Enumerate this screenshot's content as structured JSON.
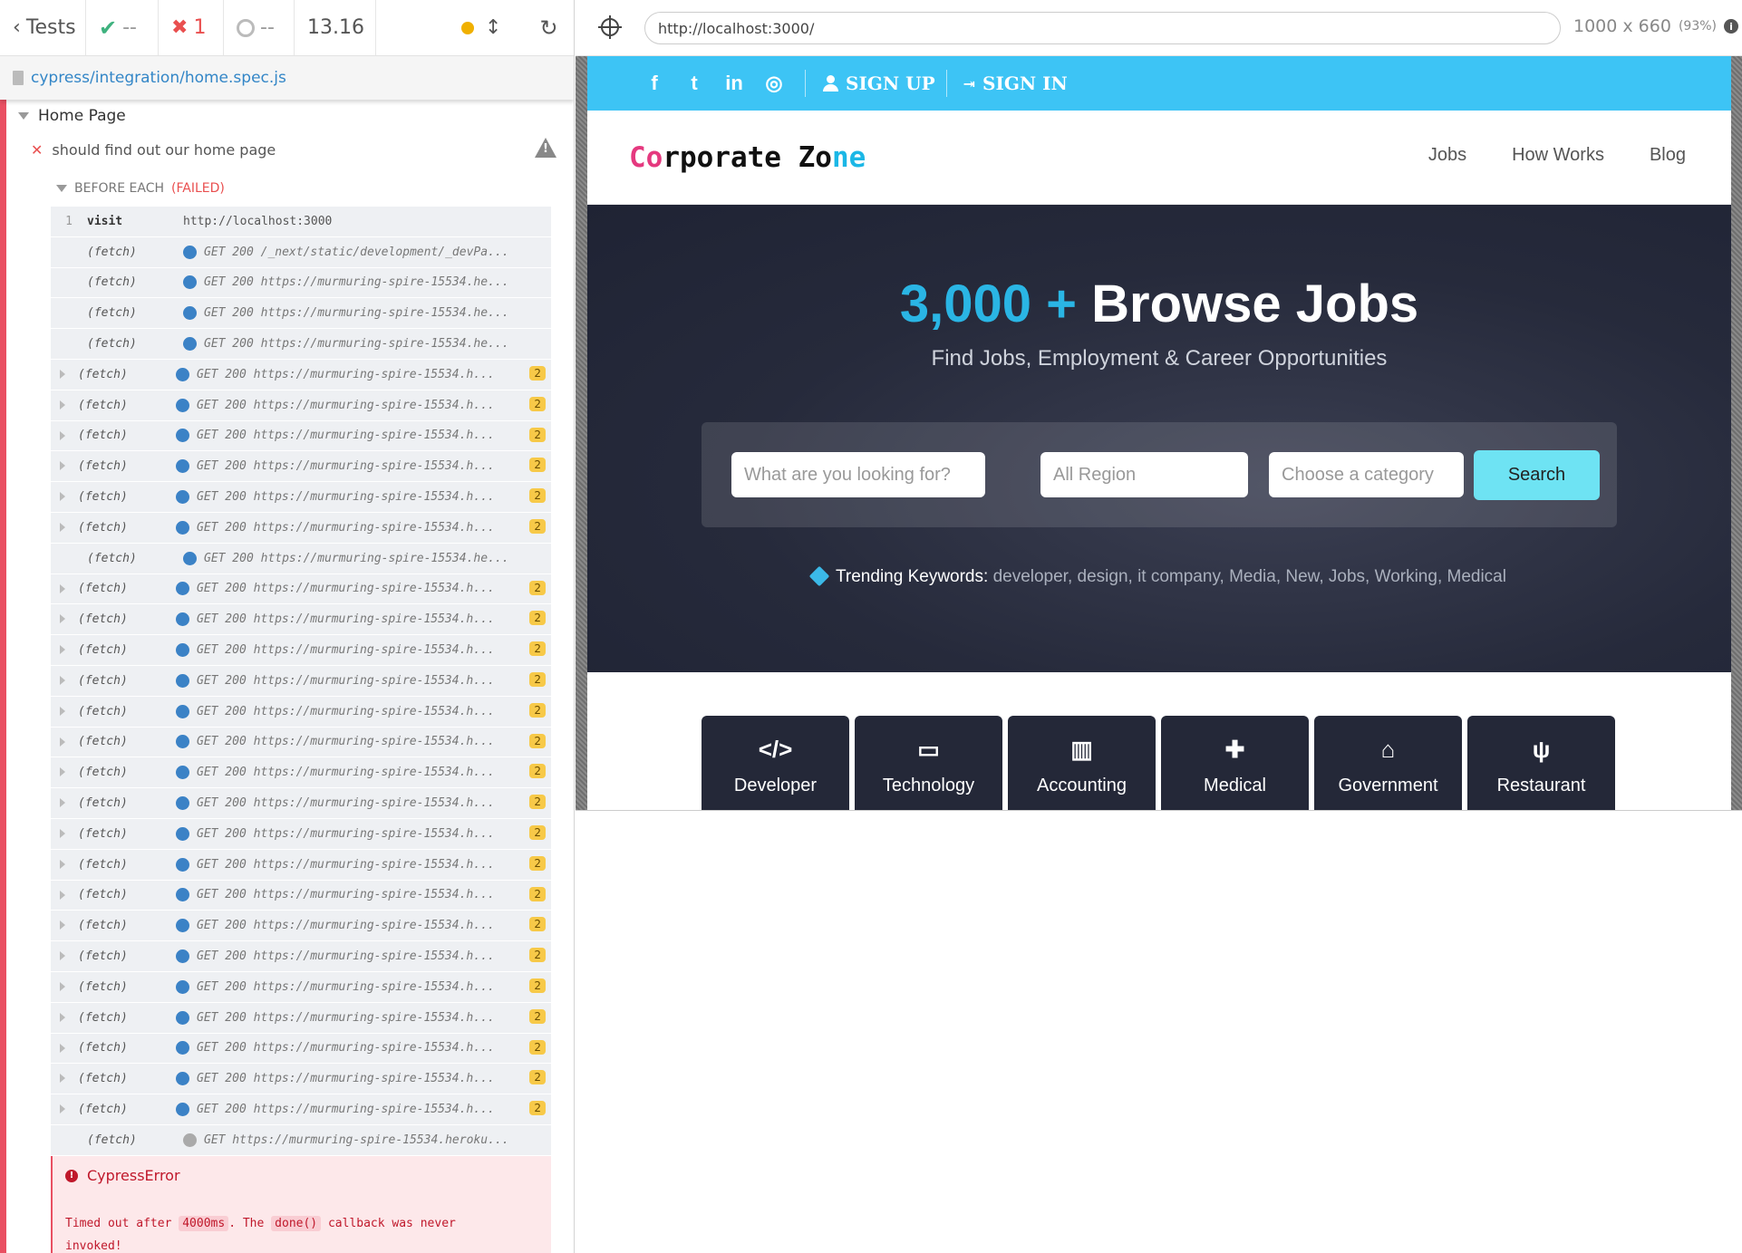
{
  "reporter": {
    "tests_label": "Tests",
    "passed": "--",
    "failed": "1",
    "pending": "--",
    "duration": "13.16",
    "spec_path": "cypress/integration/home.spec.js",
    "suite_title": "Home Page",
    "test_title": "should find out our home page",
    "hook_label": "BEFORE EACH",
    "hook_status": "(FAILED)",
    "commands": [
      {
        "num": "1",
        "name": "visit",
        "msg": "http://localhost:3000",
        "type": "visit"
      },
      {
        "name": "(fetch)",
        "msg": "GET 200 /_next/static/development/_devPa...",
        "type": "plain"
      },
      {
        "name": "(fetch)",
        "msg": "GET 200 https://murmuring-spire-15534.he...",
        "type": "plain"
      },
      {
        "name": "(fetch)",
        "msg": "GET 200 https://murmuring-spire-15534.he...",
        "type": "plain"
      },
      {
        "name": "(fetch)",
        "msg": "GET 200 https://murmuring-spire-15534.he...",
        "type": "plain"
      },
      {
        "name": "(fetch)",
        "msg": "GET 200 https://murmuring-spire-15534.h...",
        "type": "exp",
        "badge": "2"
      },
      {
        "name": "(fetch)",
        "msg": "GET 200 https://murmuring-spire-15534.h...",
        "type": "exp",
        "badge": "2"
      },
      {
        "name": "(fetch)",
        "msg": "GET 200 https://murmuring-spire-15534.h...",
        "type": "exp",
        "badge": "2"
      },
      {
        "name": "(fetch)",
        "msg": "GET 200 https://murmuring-spire-15534.h...",
        "type": "exp",
        "badge": "2"
      },
      {
        "name": "(fetch)",
        "msg": "GET 200 https://murmuring-spire-15534.h...",
        "type": "exp",
        "badge": "2"
      },
      {
        "name": "(fetch)",
        "msg": "GET 200 https://murmuring-spire-15534.h...",
        "type": "exp",
        "badge": "2"
      },
      {
        "name": "(fetch)",
        "msg": "GET 200 https://murmuring-spire-15534.he...",
        "type": "plain"
      },
      {
        "name": "(fetch)",
        "msg": "GET 200 https://murmuring-spire-15534.h...",
        "type": "exp",
        "badge": "2"
      },
      {
        "name": "(fetch)",
        "msg": "GET 200 https://murmuring-spire-15534.h...",
        "type": "exp",
        "badge": "2"
      },
      {
        "name": "(fetch)",
        "msg": "GET 200 https://murmuring-spire-15534.h...",
        "type": "exp",
        "badge": "2"
      },
      {
        "name": "(fetch)",
        "msg": "GET 200 https://murmuring-spire-15534.h...",
        "type": "exp",
        "badge": "2"
      },
      {
        "name": "(fetch)",
        "msg": "GET 200 https://murmuring-spire-15534.h...",
        "type": "exp",
        "badge": "2"
      },
      {
        "name": "(fetch)",
        "msg": "GET 200 https://murmuring-spire-15534.h...",
        "type": "exp",
        "badge": "2"
      },
      {
        "name": "(fetch)",
        "msg": "GET 200 https://murmuring-spire-15534.h...",
        "type": "exp",
        "badge": "2"
      },
      {
        "name": "(fetch)",
        "msg": "GET 200 https://murmuring-spire-15534.h...",
        "type": "exp",
        "badge": "2"
      },
      {
        "name": "(fetch)",
        "msg": "GET 200 https://murmuring-spire-15534.h...",
        "type": "exp",
        "badge": "2"
      },
      {
        "name": "(fetch)",
        "msg": "GET 200 https://murmuring-spire-15534.h...",
        "type": "exp",
        "badge": "2"
      },
      {
        "name": "(fetch)",
        "msg": "GET 200 https://murmuring-spire-15534.h...",
        "type": "exp",
        "badge": "2"
      },
      {
        "name": "(fetch)",
        "msg": "GET 200 https://murmuring-spire-15534.h...",
        "type": "exp",
        "badge": "2"
      },
      {
        "name": "(fetch)",
        "msg": "GET 200 https://murmuring-spire-15534.h...",
        "type": "exp",
        "badge": "2"
      },
      {
        "name": "(fetch)",
        "msg": "GET 200 https://murmuring-spire-15534.h...",
        "type": "exp",
        "badge": "2"
      },
      {
        "name": "(fetch)",
        "msg": "GET 200 https://murmuring-spire-15534.h...",
        "type": "exp",
        "badge": "2"
      },
      {
        "name": "(fetch)",
        "msg": "GET 200 https://murmuring-spire-15534.h...",
        "type": "exp",
        "badge": "2"
      },
      {
        "name": "(fetch)",
        "msg": "GET 200 https://murmuring-spire-15534.h...",
        "type": "exp",
        "badge": "2"
      },
      {
        "name": "(fetch)",
        "msg": "GET 200 https://murmuring-spire-15534.h...",
        "type": "exp",
        "badge": "2"
      },
      {
        "name": "(fetch)",
        "msg": "GET https://murmuring-spire-15534.heroku...",
        "type": "pending"
      }
    ],
    "error_title": "CypressError",
    "error_msg_1": "Timed out after",
    "error_code_1": "4000ms",
    "error_msg_2": ". The",
    "error_code_2": "done()",
    "error_msg_3": "callback was never",
    "error_msg_4": "invoked!"
  },
  "aut": {
    "url": "http://localhost:3000/",
    "viewport": "1000 x 660",
    "scale": "(93%)"
  },
  "site": {
    "social": [
      "f",
      "t",
      "in",
      "◎"
    ],
    "sign_up": "SIGN UP",
    "sign_in": "SIGN IN",
    "logo": {
      "p1": "Co",
      "p2": "rporate Zo",
      "p3": "ne"
    },
    "nav": [
      "Jobs",
      "How Works",
      "Blog"
    ],
    "hero_count": "3,000 +",
    "hero_title": "Browse Jobs",
    "hero_sub": "Find Jobs, Employment & Career Opportunities",
    "search_placeholder": "What are you looking for?",
    "region_placeholder": "All Region",
    "category_placeholder": "Choose a category",
    "search_button": "Search",
    "trending_label": "Trending Keywords:",
    "trending_list": "developer, design, it company, Media, New, Jobs, Working, Medical",
    "categories": [
      {
        "label": "Developer",
        "icon": "</>"
      },
      {
        "label": "Technology",
        "icon": "▭"
      },
      {
        "label": "Accounting",
        "icon": "▥"
      },
      {
        "label": "Medical",
        "icon": "✚"
      },
      {
        "label": "Government",
        "icon": "⌂"
      },
      {
        "label": "Restaurant",
        "icon": "ψ"
      }
    ]
  }
}
